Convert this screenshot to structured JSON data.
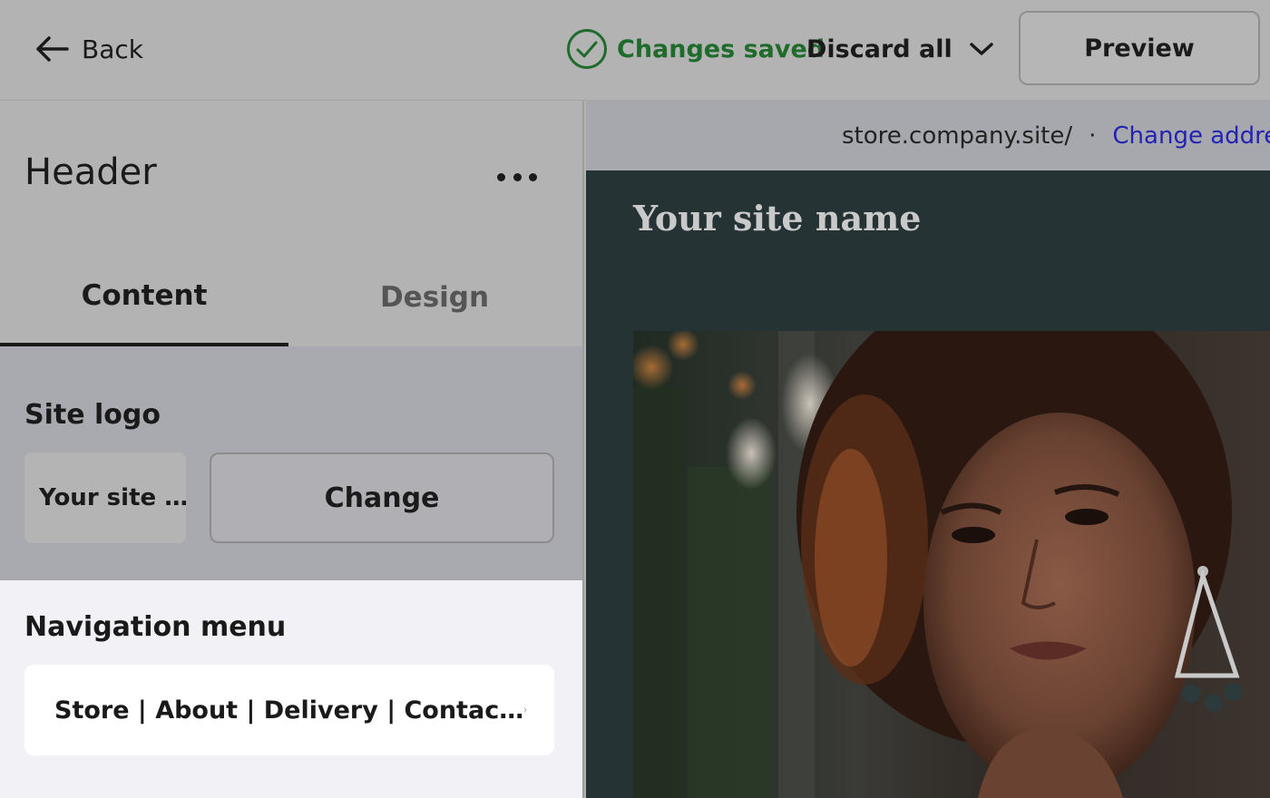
{
  "topbar": {
    "back_label": "Back",
    "status_label": "Changes saved",
    "discard_label": "Discard all",
    "preview_label": "Preview"
  },
  "panel": {
    "title": "Header",
    "tabs": [
      {
        "label": "Content",
        "active": true
      },
      {
        "label": "Design",
        "active": false
      }
    ],
    "site_logo": {
      "label": "Site logo",
      "thumb_text": "Your site …",
      "change_label": "Change"
    },
    "navigation_menu": {
      "label": "Navigation menu",
      "value": "Store | About | Delivery | Contac…"
    }
  },
  "preview": {
    "address": "store.company.site/",
    "separator": "·",
    "change_address_label": "Change addre",
    "site_name": "Your site name"
  },
  "colors": {
    "success": "#1f6b2c",
    "link": "#2323b3",
    "site_header_bg": "#263335"
  }
}
